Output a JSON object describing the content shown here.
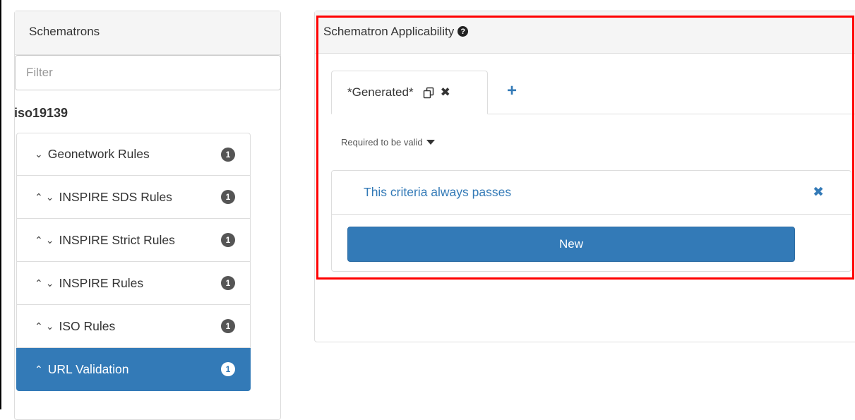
{
  "left_panel": {
    "heading": "Schematrons",
    "filter_placeholder": "Filter",
    "group": "iso19139",
    "rules": [
      {
        "label": "Geonetwork Rules",
        "up": "",
        "down": "⌄",
        "count": "1"
      },
      {
        "label": "INSPIRE SDS Rules",
        "up": "⌃",
        "down": "⌄",
        "count": "1"
      },
      {
        "label": "INSPIRE Strict Rules",
        "up": "⌃",
        "down": "⌄",
        "count": "1"
      },
      {
        "label": "INSPIRE Rules",
        "up": "⌃",
        "down": "⌄",
        "count": "1"
      },
      {
        "label": "ISO Rules",
        "up": "⌃",
        "down": "⌄",
        "count": "1"
      },
      {
        "label": "URL Validation",
        "up": "⌃",
        "down": "",
        "count": "1",
        "active": true
      }
    ]
  },
  "right_panel": {
    "heading": "Schematron Applicability",
    "help_icon": "question-circle-icon",
    "tab_label": "*Generated*",
    "tab_close": "✖",
    "add_tab": "+",
    "requirement": "Required to be valid",
    "criteria_text": "This criteria always passes",
    "criteria_remove": "✖",
    "new_button": "New"
  },
  "colors": {
    "accent": "#337ab7",
    "highlight_border": "#ff0000",
    "badge": "#555555"
  }
}
